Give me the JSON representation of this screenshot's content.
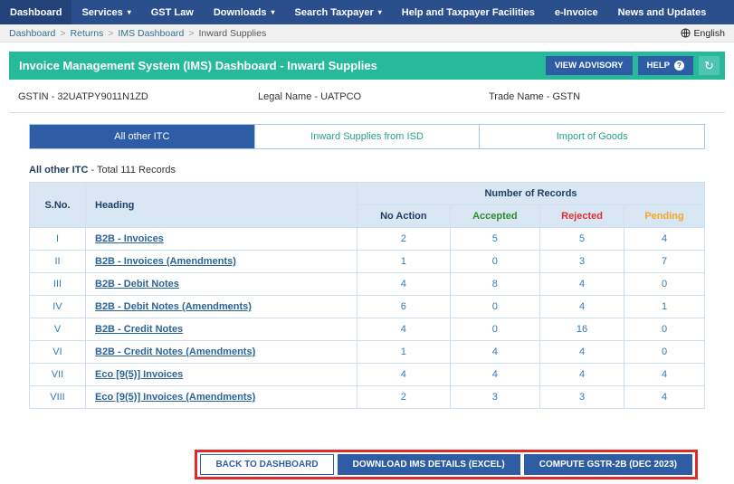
{
  "icons": {
    "caret_down": "▾",
    "refresh": "↻",
    "help_q": "?"
  },
  "nav": {
    "items": [
      {
        "label": "Dashboard"
      },
      {
        "label": "Services"
      },
      {
        "label": "GST Law"
      },
      {
        "label": "Downloads"
      },
      {
        "label": "Search Taxpayer"
      },
      {
        "label": "Help and Taxpayer Facilities"
      },
      {
        "label": "e-Invoice"
      },
      {
        "label": "News and Updates"
      }
    ]
  },
  "breadcrumb": {
    "separator": ">",
    "items": [
      "Dashboard",
      "Returns",
      "IMS Dashboard",
      "Inward Supplies"
    ],
    "language": "English"
  },
  "header": {
    "title": "Invoice Management System (IMS) Dashboard - Inward Supplies",
    "view_advisory": "VIEW ADVISORY",
    "help": "HELP"
  },
  "taxpayer": {
    "gstin": "GSTIN - 32UATPY9011N1ZD",
    "legal_name": "Legal Name - UATPCO",
    "trade_name": "Trade Name - GSTN"
  },
  "tabs": [
    {
      "label": "All other ITC"
    },
    {
      "label": "Inward Supplies from ISD"
    },
    {
      "label": "Import of Goods"
    }
  ],
  "summary": {
    "title": "All other ITC",
    "subtitle": " - Total 111 Records"
  },
  "table": {
    "col_sno": "S.No.",
    "col_heading": "Heading",
    "group_header": "Number of Records",
    "sub_no_action": "No Action",
    "sub_accepted": "Accepted",
    "sub_rejected": "Rejected",
    "sub_pending": "Pending",
    "rows": [
      {
        "sno": "I",
        "heading": "B2B - Invoices",
        "no_action": "2",
        "accepted": "5",
        "rejected": "5",
        "pending": "4"
      },
      {
        "sno": "II",
        "heading": "B2B - Invoices (Amendments)",
        "no_action": "1",
        "accepted": "0",
        "rejected": "3",
        "pending": "7"
      },
      {
        "sno": "III",
        "heading": "B2B - Debit Notes",
        "no_action": "4",
        "accepted": "8",
        "rejected": "4",
        "pending": "0"
      },
      {
        "sno": "IV",
        "heading": "B2B - Debit Notes (Amendments)",
        "no_action": "6",
        "accepted": "0",
        "rejected": "4",
        "pending": "1"
      },
      {
        "sno": "V",
        "heading": "B2B - Credit Notes",
        "no_action": "4",
        "accepted": "0",
        "rejected": "16",
        "pending": "0"
      },
      {
        "sno": "VI",
        "heading": "B2B - Credit Notes (Amendments)",
        "no_action": "1",
        "accepted": "4",
        "rejected": "4",
        "pending": "0"
      },
      {
        "sno": "VII",
        "heading": "Eco [9(5)] Invoices",
        "no_action": "4",
        "accepted": "4",
        "rejected": "4",
        "pending": "4"
      },
      {
        "sno": "VIII",
        "heading": "Eco [9(5)] Invoices (Amendments)",
        "no_action": "2",
        "accepted": "3",
        "rejected": "3",
        "pending": "4"
      }
    ]
  },
  "footer": {
    "back": "BACK TO DASHBOARD",
    "download": "DOWNLOAD IMS DETAILS (EXCEL)",
    "compute": "COMPUTE GSTR-2B (DEC 2023)"
  }
}
